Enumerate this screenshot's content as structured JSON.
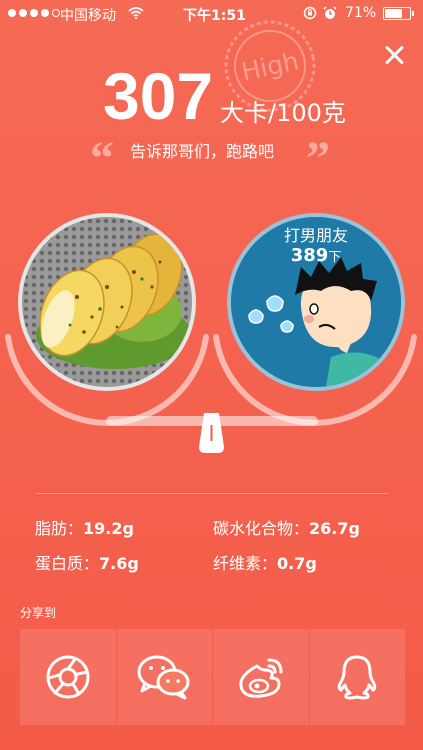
{
  "status_bar": {
    "carrier": "中国移动",
    "time": "下午1:51",
    "battery": "71%",
    "battery_level": 0.71,
    "signal_bars": 4
  },
  "stamp": "High",
  "food": {
    "calories": "307",
    "unit": "大卡/100克",
    "quote_open": "“",
    "quote_close": "”",
    "slogan": "告诉那哥们，跑路吧"
  },
  "activity": {
    "name": "打男朋友",
    "count": "389",
    "count_unit": "下"
  },
  "nutrients": {
    "fat": {
      "label": "脂肪：",
      "value": "19.2g"
    },
    "carbs": {
      "label": "碳水化合物：",
      "value": "26.7g"
    },
    "protein": {
      "label": "蛋白质：",
      "value": "7.6g"
    },
    "fiber": {
      "label": "纤维素：",
      "value": "0.7g"
    }
  },
  "share": {
    "title": "分享到",
    "buttons": [
      {
        "icon": "camera-shutter-icon"
      },
      {
        "icon": "wechat-icon"
      },
      {
        "icon": "weibo-icon"
      },
      {
        "icon": "qq-icon"
      }
    ]
  },
  "colors": {
    "background": "#f45b49",
    "activity_circle": "#1f7aa8"
  }
}
